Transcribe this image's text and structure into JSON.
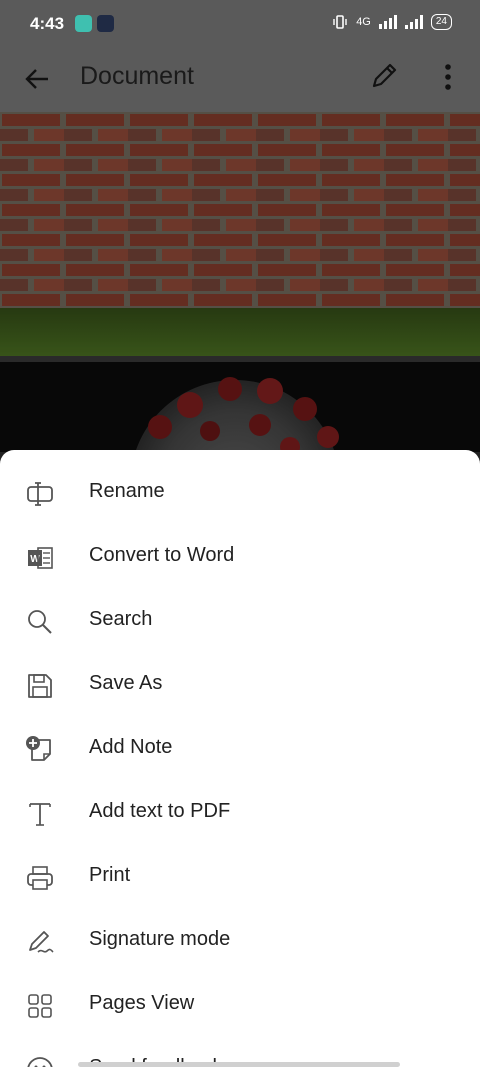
{
  "status": {
    "time": "4:43",
    "network": "4G",
    "battery": "24"
  },
  "app_bar": {
    "title": "Document",
    "back_icon": "arrow-left-icon",
    "edit_icon": "pencil-icon",
    "more_icon": "more-vert-icon"
  },
  "menu": {
    "items": [
      {
        "label": "Rename",
        "icon": "rename-icon"
      },
      {
        "label": "Convert to Word",
        "icon": "word-icon"
      },
      {
        "label": "Search",
        "icon": "search-icon"
      },
      {
        "label": "Save As",
        "icon": "save-icon"
      },
      {
        "label": "Add Note",
        "icon": "add-note-icon"
      },
      {
        "label": "Add text to PDF",
        "icon": "text-icon"
      },
      {
        "label": "Print",
        "icon": "print-icon"
      },
      {
        "label": "Signature mode",
        "icon": "signature-icon"
      },
      {
        "label": "Pages View",
        "icon": "grid-icon"
      },
      {
        "label": "Send feedback",
        "icon": "feedback-icon"
      }
    ]
  },
  "colors": {
    "scrim_bar": "#5a5a5a",
    "sheet": "#ffffff",
    "text": "#222222"
  }
}
